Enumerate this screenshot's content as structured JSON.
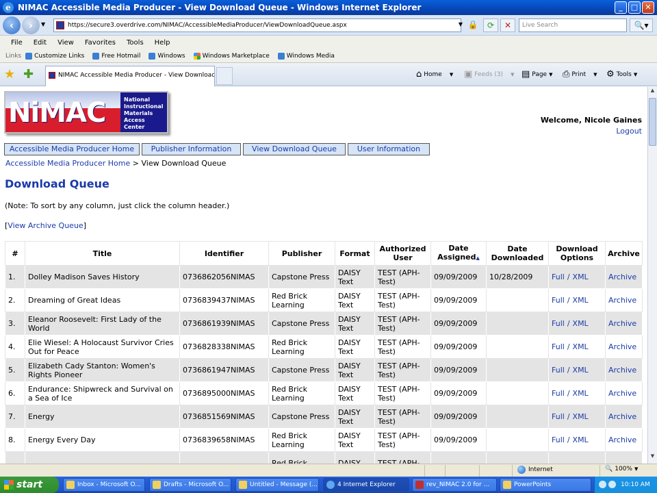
{
  "window": {
    "title": "NIMAC Accessible Media Producer - View Download Queue - Windows Internet Explorer"
  },
  "address_bar": {
    "url": "https://secure3.overdrive.com/NIMAC/AccessibleMediaProducer/ViewDownloadQueue.aspx",
    "search_placeholder": "Live Search"
  },
  "menu": [
    "File",
    "Edit",
    "View",
    "Favorites",
    "Tools",
    "Help"
  ],
  "links_bar": {
    "label": "Links",
    "items": [
      "Customize Links",
      "Free Hotmail",
      "Windows",
      "Windows Marketplace",
      "Windows Media"
    ]
  },
  "tab": {
    "title": "NIMAC Accessible Media Producer - View Download Q..."
  },
  "command_bar": {
    "home": "Home",
    "feeds": "Feeds (3)",
    "page": "Page",
    "print": "Print",
    "tools": "Tools"
  },
  "site": {
    "logo_text": "NiMAC",
    "logo_subtitle": [
      "National",
      "Instructional",
      "Materials",
      "Access",
      "Center"
    ],
    "welcome": "Welcome, Nicole Gaines",
    "logout": "Logout",
    "nav": [
      "Accessible Media Producer Home",
      "Publisher Information",
      "View Download Queue",
      "User Information"
    ],
    "breadcrumb": {
      "home": "Accessible Media Producer Home",
      "separator": ">",
      "current": "View Download Queue"
    },
    "heading": "Download Queue",
    "note": "(Note: To sort by any column, just click the column header.)",
    "archive_link": "View Archive Queue"
  },
  "table": {
    "headers": [
      "#",
      "Title",
      "Identifier",
      "Publisher",
      "Format",
      "Authorized User",
      "Date Assigned",
      "Date Downloaded",
      "Download Options",
      "Archive"
    ],
    "sort_indicator": "▲",
    "rows": [
      {
        "num": "1.",
        "title": "Dolley Madison Saves History",
        "identifier": "0736862056NIMAS",
        "publisher": "Capstone Press",
        "format": "DAISY Text",
        "user": "TEST (APH-Test)",
        "assigned": "09/09/2009",
        "downloaded": "10/28/2009",
        "full": "Full",
        "sep": "/",
        "xml": "XML",
        "archive": "Archive"
      },
      {
        "num": "2.",
        "title": "Dreaming of Great Ideas",
        "identifier": "0736839437NIMAS",
        "publisher": "Red Brick Learning",
        "format": "DAISY Text",
        "user": "TEST (APH-Test)",
        "assigned": "09/09/2009",
        "downloaded": "",
        "full": "Full",
        "sep": "/",
        "xml": "XML",
        "archive": "Archive"
      },
      {
        "num": "3.",
        "title": "Eleanor Roosevelt: First Lady of the World",
        "identifier": "0736861939NIMAS",
        "publisher": "Capstone Press",
        "format": "DAISY Text",
        "user": "TEST (APH-Test)",
        "assigned": "09/09/2009",
        "downloaded": "",
        "full": "Full",
        "sep": "/",
        "xml": "XML",
        "archive": "Archive"
      },
      {
        "num": "4.",
        "title": "Elie Wiesel: A Holocaust Survivor Cries Out for Peace",
        "identifier": "0736828338NIMAS",
        "publisher": "Red Brick Learning",
        "format": "DAISY Text",
        "user": "TEST (APH-Test)",
        "assigned": "09/09/2009",
        "downloaded": "",
        "full": "Full",
        "sep": "/",
        "xml": "XML",
        "archive": "Archive"
      },
      {
        "num": "5.",
        "title": "Elizabeth Cady Stanton: Women's Rights Pioneer",
        "identifier": "0736861947NIMAS",
        "publisher": "Capstone Press",
        "format": "DAISY Text",
        "user": "TEST (APH-Test)",
        "assigned": "09/09/2009",
        "downloaded": "",
        "full": "Full",
        "sep": "/",
        "xml": "XML",
        "archive": "Archive"
      },
      {
        "num": "6.",
        "title": "Endurance: Shipwreck and Survival on a Sea of Ice",
        "identifier": "0736895000NIMAS",
        "publisher": "Red Brick Learning",
        "format": "DAISY Text",
        "user": "TEST (APH-Test)",
        "assigned": "09/09/2009",
        "downloaded": "",
        "full": "Full",
        "sep": "/",
        "xml": "XML",
        "archive": "Archive"
      },
      {
        "num": "7.",
        "title": "Energy",
        "identifier": "0736851569NIMAS",
        "publisher": "Capstone Press",
        "format": "DAISY Text",
        "user": "TEST (APH-Test)",
        "assigned": "09/09/2009",
        "downloaded": "",
        "full": "Full",
        "sep": "/",
        "xml": "XML",
        "archive": "Archive"
      },
      {
        "num": "8.",
        "title": "Energy Every Day",
        "identifier": "0736839658NIMAS",
        "publisher": "Red Brick Learning",
        "format": "DAISY Text",
        "user": "TEST (APH-Test)",
        "assigned": "09/09/2009",
        "downloaded": "",
        "full": "Full",
        "sep": "/",
        "xml": "XML",
        "archive": "Archive"
      },
      {
        "num": "",
        "title": "",
        "identifier": "",
        "publisher": "Red Brick",
        "format": "DAISY",
        "user": "TEST (APH-",
        "assigned": "",
        "downloaded": "",
        "full": "",
        "sep": "",
        "xml": "",
        "archive": ""
      }
    ]
  },
  "status_bar": {
    "zone": "Internet",
    "zoom": "100%"
  },
  "taskbar": {
    "start": "start",
    "tasks": [
      "Inbox - Microsoft O...",
      "Drafts - Microsoft O...",
      "Untitled - Message (...",
      "4 Internet Explorer",
      "rev_NIMAC 2.0 for ...",
      "PowerPoints"
    ],
    "clock": "10:10 AM"
  },
  "colors": {
    "link": "#1a3aa8",
    "row_shade": "#e4e4e4",
    "logo_red": "#d81e2c",
    "logo_blue": "#1a1a8c"
  }
}
